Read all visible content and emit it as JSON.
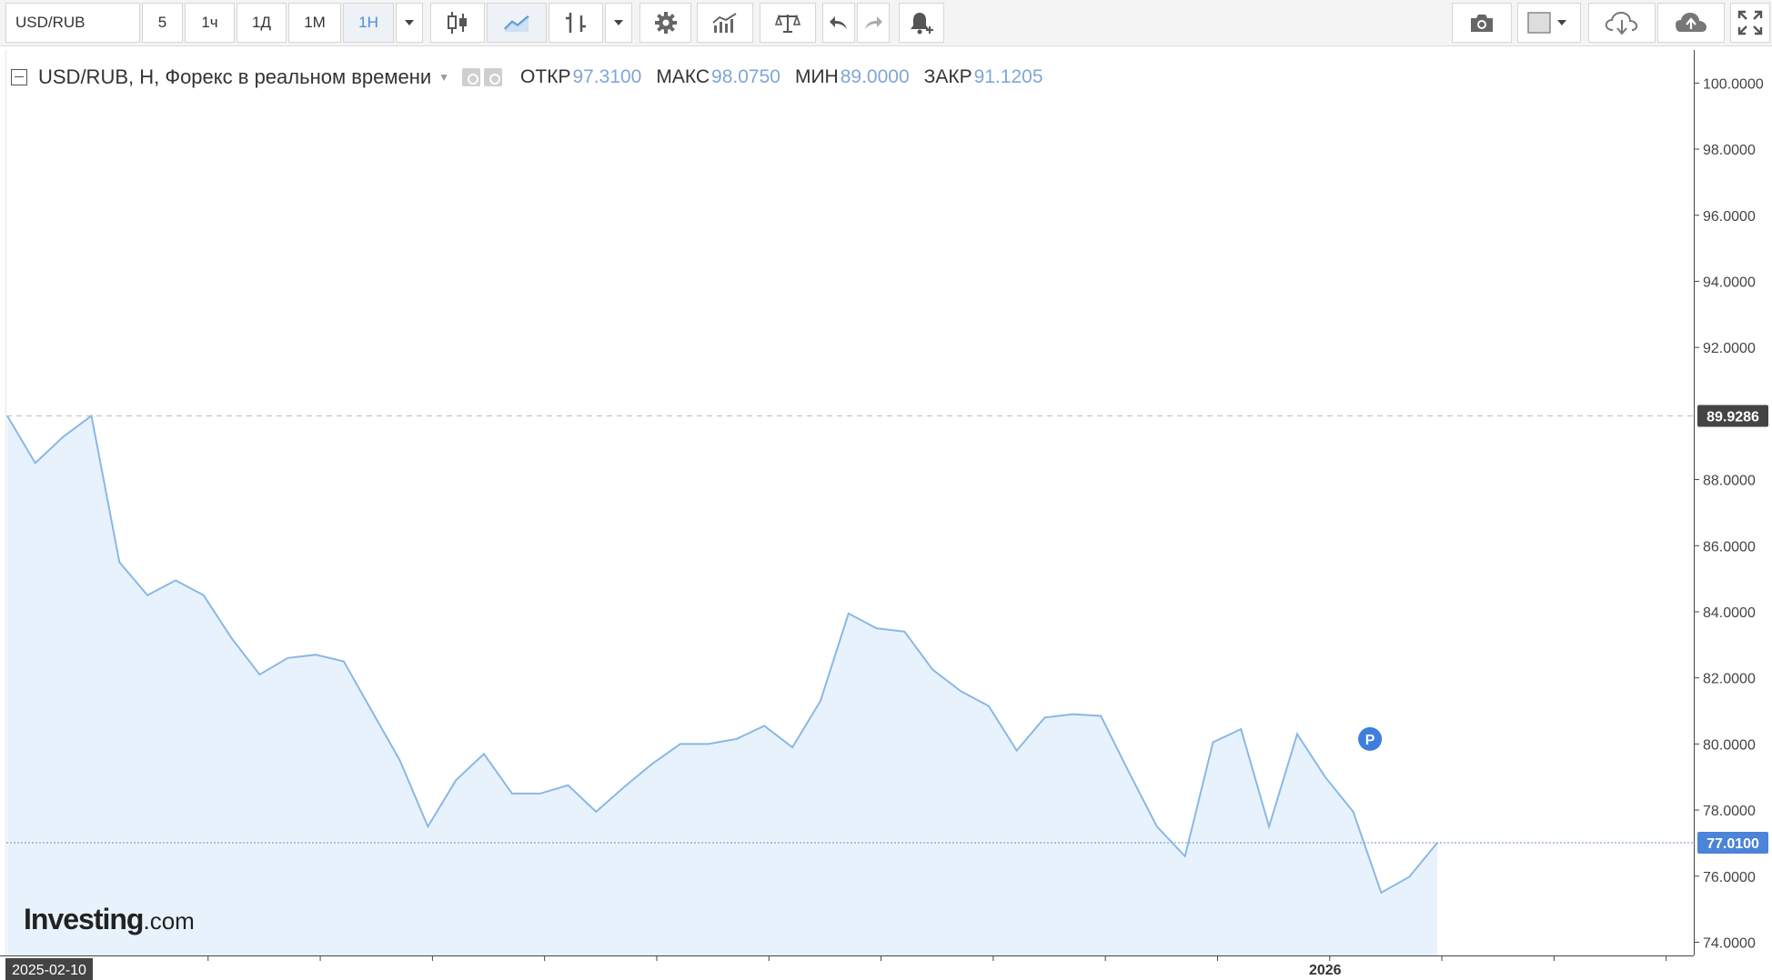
{
  "toolbar": {
    "symbol": "USD/RUB",
    "intervals": [
      {
        "label": "5",
        "active": false
      },
      {
        "label": "1ч",
        "active": false
      },
      {
        "label": "1Д",
        "active": false
      },
      {
        "label": "1М",
        "active": false
      },
      {
        "label": "1Н",
        "active": true
      }
    ]
  },
  "legend": {
    "title": "USD/RUB, H, Форекс в реальном времени",
    "open_label": "ОТКР",
    "open_value": "97.3100",
    "high_label": "МАКС",
    "high_value": "98.0750",
    "low_label": "МИН",
    "low_value": "89.0000",
    "close_label": "ЗАКР",
    "close_value": "91.1205"
  },
  "logo": {
    "main": "Investing",
    "suffix": ".com"
  },
  "marker": {
    "label": "P",
    "color": "#3d7ee0"
  },
  "colors": {
    "line": "#8ab8e4",
    "fill": "#e8f2fc",
    "current_badge": "#4b84d8",
    "ref_badge": "#444444"
  },
  "chart_data": {
    "type": "area",
    "ylim": [
      73.6,
      101.0
    ],
    "yticks": [
      "74.0000",
      "76.0000",
      "78.0000",
      "80.0000",
      "82.0000",
      "84.0000",
      "86.0000",
      "88.0000",
      "92.0000",
      "94.0000",
      "96.0000",
      "98.0000",
      "100.0000"
    ],
    "reference_line": {
      "value": 89.9286,
      "label": "89.9286"
    },
    "current_line": {
      "value": 77.01,
      "label": "77.0100"
    },
    "x_labels": [
      {
        "index": 0,
        "label": "2025-02-10"
      },
      {
        "index": 47,
        "label": "2026"
      }
    ],
    "values": [
      89.93,
      88.5,
      89.3,
      89.93,
      85.5,
      84.5,
      84.95,
      84.5,
      83.2,
      82.1,
      82.6,
      82.7,
      82.5,
      81.0,
      79.5,
      77.5,
      78.9,
      79.7,
      78.5,
      78.5,
      78.75,
      77.95,
      78.7,
      79.4,
      80.0,
      80.0,
      80.15,
      80.55,
      79.9,
      81.3,
      83.95,
      83.5,
      83.4,
      82.25,
      81.6,
      81.15,
      79.8,
      80.8,
      80.9,
      80.85,
      79.15,
      77.5,
      76.6,
      80.05,
      80.45,
      77.5,
      80.3,
      79.0,
      77.95,
      75.5,
      75.98,
      77.01
    ],
    "total_slots": 61
  }
}
